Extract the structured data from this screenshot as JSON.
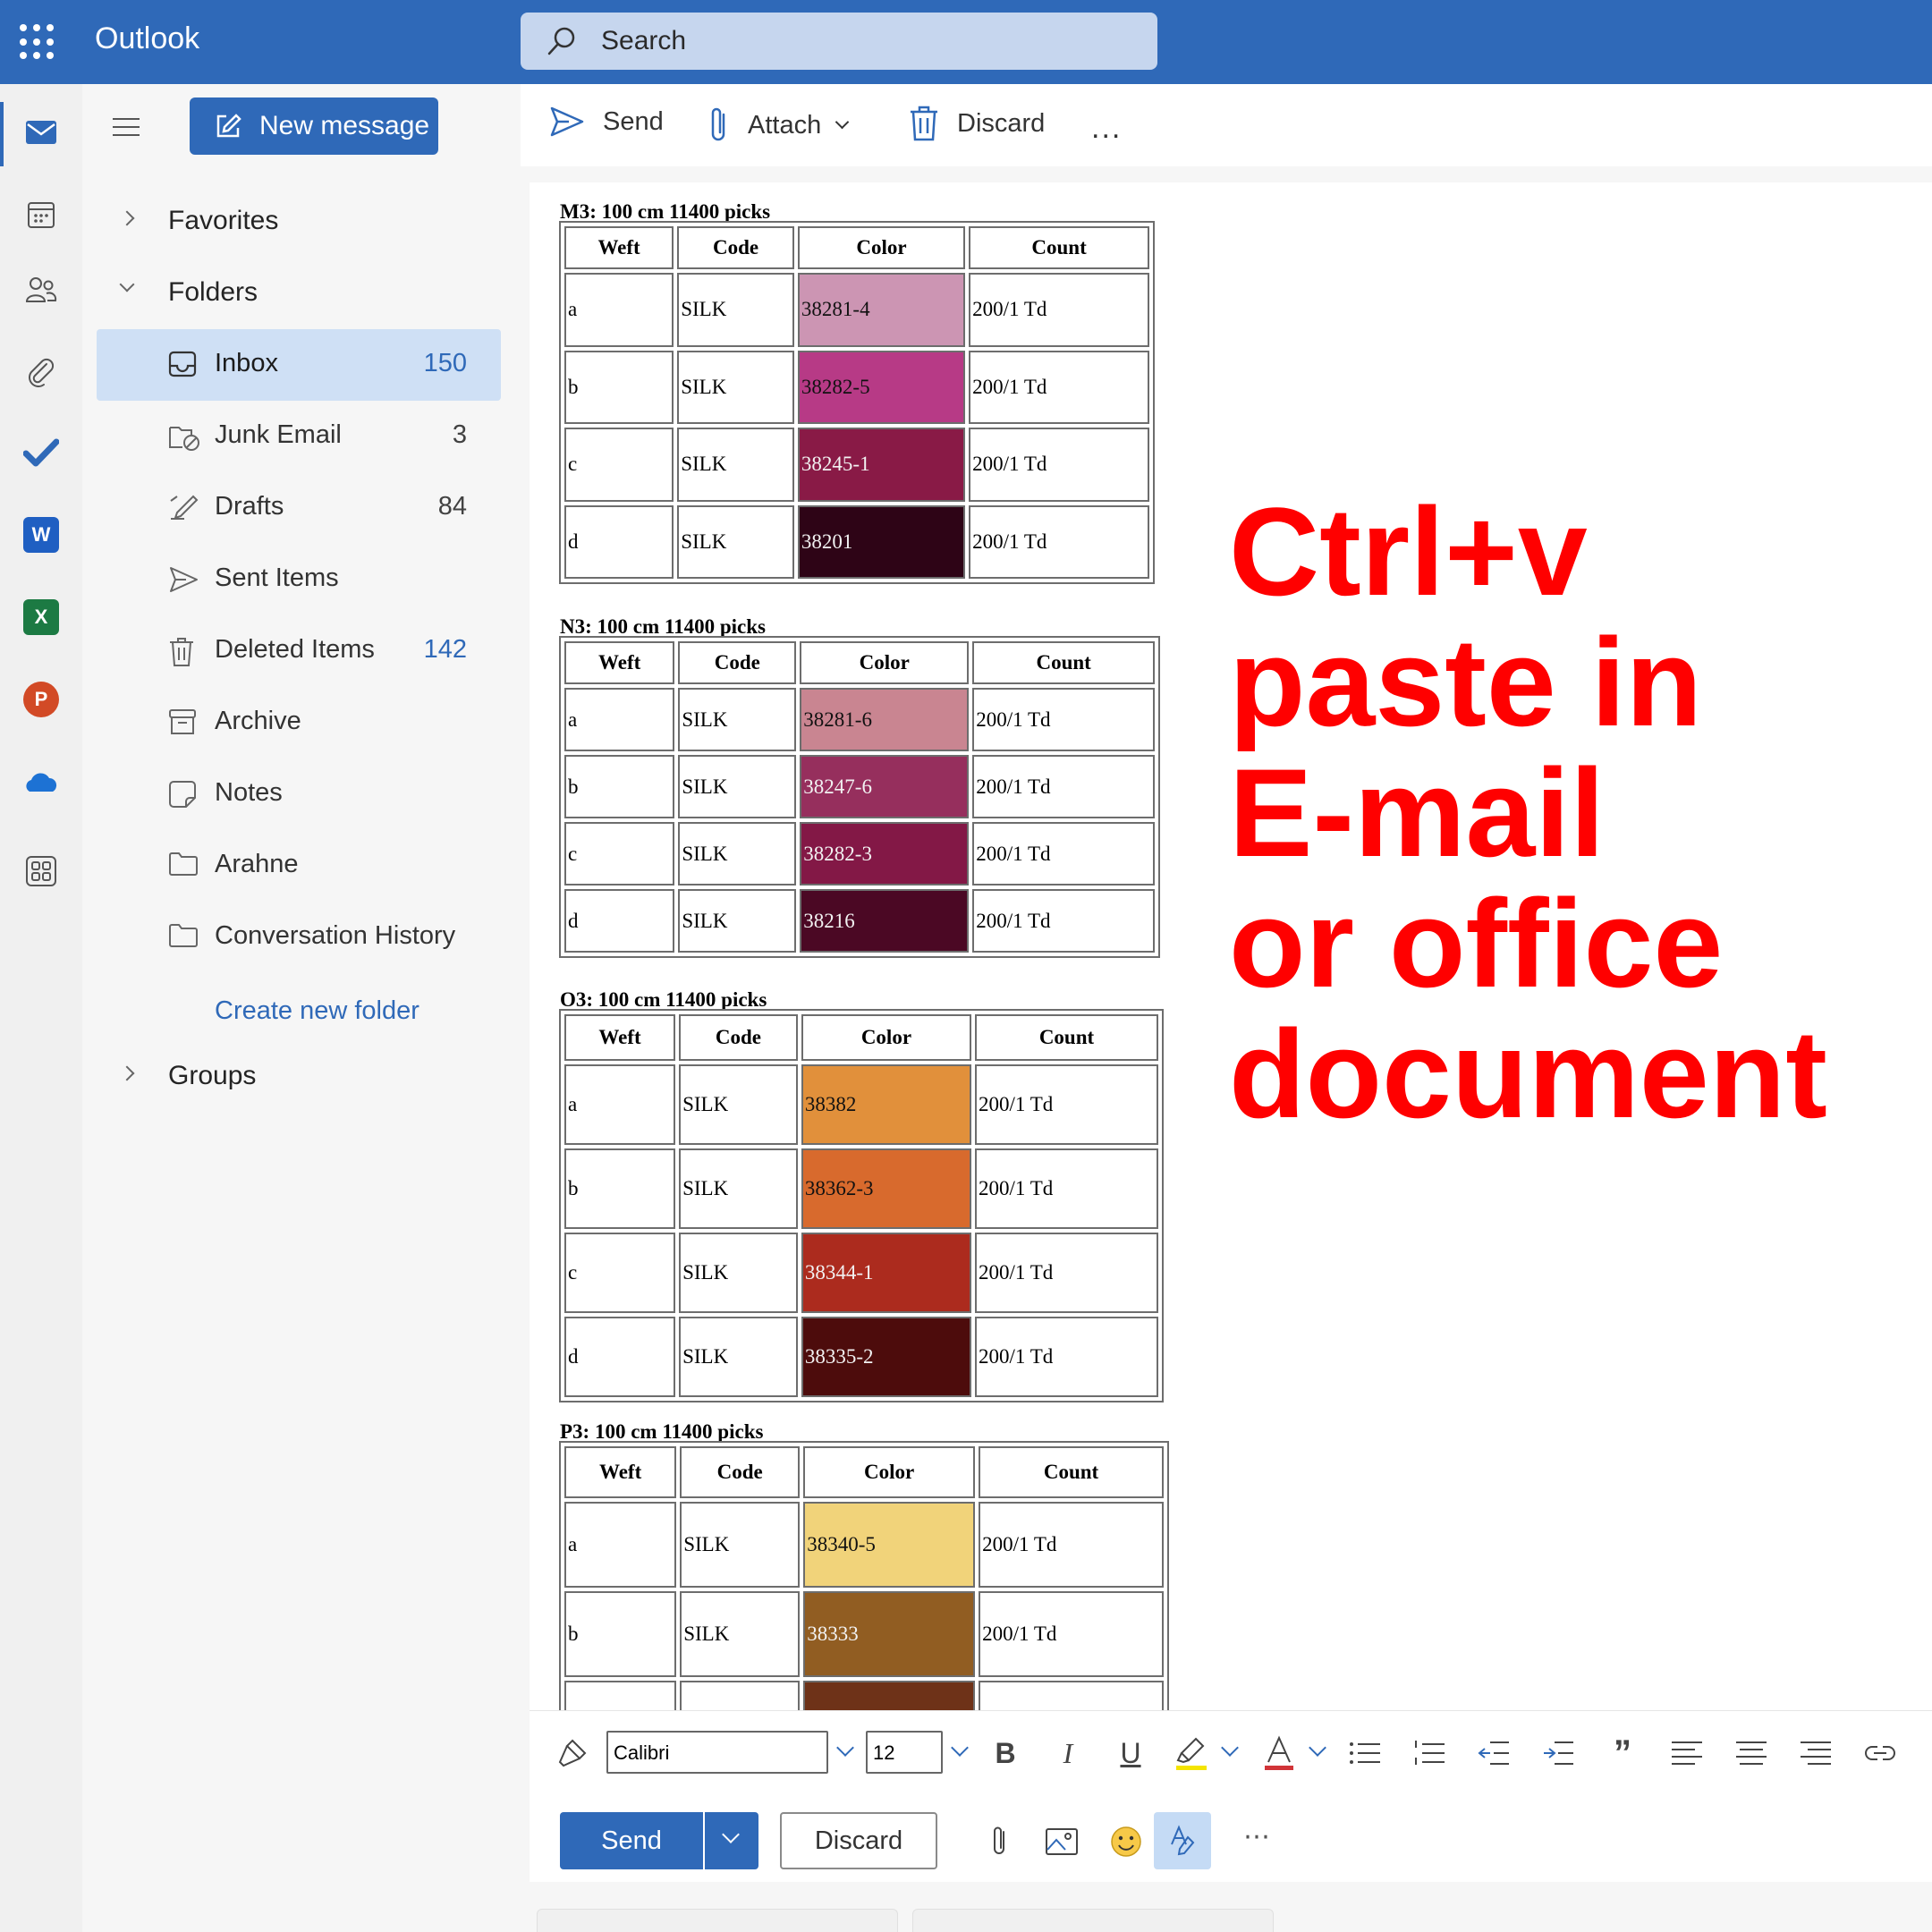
{
  "app": {
    "title": "Outlook"
  },
  "search": {
    "placeholder": "Search"
  },
  "rail": {
    "items": [
      "mail-icon",
      "calendar-icon",
      "people-icon",
      "attachments-icon",
      "todo-icon",
      "word-icon",
      "excel-icon",
      "powerpoint-icon",
      "onedrive-icon",
      "more-apps-icon"
    ],
    "word_letter": "W",
    "excel_letter": "X",
    "powerpoint_letter": "P"
  },
  "folderpane": {
    "new_message": "New message",
    "favorites": "Favorites",
    "folders_header": "Folders",
    "folders": [
      {
        "name": "Inbox",
        "count": "150",
        "selected": true,
        "icon": "inbox-icon"
      },
      {
        "name": "Junk Email",
        "count": "3",
        "icon": "junk-icon"
      },
      {
        "name": "Drafts",
        "count": "84",
        "icon": "drafts-icon"
      },
      {
        "name": "Sent Items",
        "count": "",
        "icon": "sent-icon"
      },
      {
        "name": "Deleted Items",
        "count": "142",
        "icon": "trash-icon"
      },
      {
        "name": "Archive",
        "count": "",
        "icon": "archive-icon"
      },
      {
        "name": "Notes",
        "count": "",
        "icon": "notes-icon"
      },
      {
        "name": "Arahne",
        "count": "",
        "icon": "folder-icon"
      },
      {
        "name": "Conversation History",
        "count": "",
        "icon": "folder-icon"
      }
    ],
    "create_folder": "Create new folder",
    "groups": "Groups"
  },
  "compose_toolbar": {
    "send": "Send",
    "attach": "Attach",
    "discard": "Discard",
    "more": "..."
  },
  "tables": {
    "headers": {
      "weft": "Weft",
      "code": "Code",
      "color": "Color",
      "count": "Count"
    },
    "t1": {
      "title": "M3: 100 cm 11400 picks",
      "rows": [
        {
          "weft": "a",
          "code": "SILK",
          "color": "38281-4",
          "count": "200/1 Td",
          "swatch": "#cc95b3"
        },
        {
          "weft": "b",
          "code": "SILK",
          "color": "38282-5",
          "count": "200/1 Td",
          "swatch": "#b73a86"
        },
        {
          "weft": "c",
          "code": "SILK",
          "color": "38245-1",
          "count": "200/1 Td",
          "swatch": "#891a46"
        },
        {
          "weft": "d",
          "code": "SILK",
          "color": "38201",
          "count": "200/1 Td",
          "swatch": "#2e0416"
        }
      ]
    },
    "t2": {
      "title": "N3: 100 cm 11400 picks",
      "rows": [
        {
          "weft": "a",
          "code": "SILK",
          "color": "38281-6",
          "count": "200/1 Td",
          "swatch": "#c98591"
        },
        {
          "weft": "b",
          "code": "SILK",
          "color": "38247-6",
          "count": "200/1 Td",
          "swatch": "#962f5d"
        },
        {
          "weft": "c",
          "code": "SILK",
          "color": "38282-3",
          "count": "200/1 Td",
          "swatch": "#831846"
        },
        {
          "weft": "d",
          "code": "SILK",
          "color": "38216",
          "count": "200/1 Td",
          "swatch": "#4b0824"
        }
      ]
    },
    "t3": {
      "title": "O3: 100 cm 11400 picks",
      "rows": [
        {
          "weft": "a",
          "code": "SILK",
          "color": "38382",
          "count": "200/1 Td",
          "swatch": "#e1903b"
        },
        {
          "weft": "b",
          "code": "SILK",
          "color": "38362-3",
          "count": "200/1 Td",
          "swatch": "#d86a2d"
        },
        {
          "weft": "c",
          "code": "SILK",
          "color": "38344-1",
          "count": "200/1 Td",
          "swatch": "#ac2b1e"
        },
        {
          "weft": "d",
          "code": "SILK",
          "color": "38335-2",
          "count": "200/1 Td",
          "swatch": "#4d0c0c"
        }
      ]
    },
    "t4": {
      "title": "P3: 100 cm 11400 picks",
      "rows": [
        {
          "weft": "a",
          "code": "SILK",
          "color": "38340-5",
          "count": "200/1 Td",
          "swatch": "#f1d37a"
        },
        {
          "weft": "b",
          "code": "SILK",
          "color": "38333",
          "count": "200/1 Td",
          "swatch": "#915d22"
        },
        {
          "weft": "",
          "code": "",
          "color": "",
          "count": "",
          "swatch": "#6e3218"
        }
      ]
    }
  },
  "overlay": {
    "lines": [
      "Ctrl+v",
      "paste in",
      "E-mail",
      "or office",
      "document"
    ],
    "color": "#ff0000"
  },
  "formatbar": {
    "font": "Calibri",
    "size": "12",
    "bold": "B",
    "italic": "I",
    "underline": "U",
    "quote": "”"
  },
  "sendbar": {
    "send": "Send",
    "discard": "Discard"
  },
  "colors": {
    "accent": "#2f69b8",
    "topbar": "#2f69b8",
    "selected": "#cfe0f5"
  }
}
